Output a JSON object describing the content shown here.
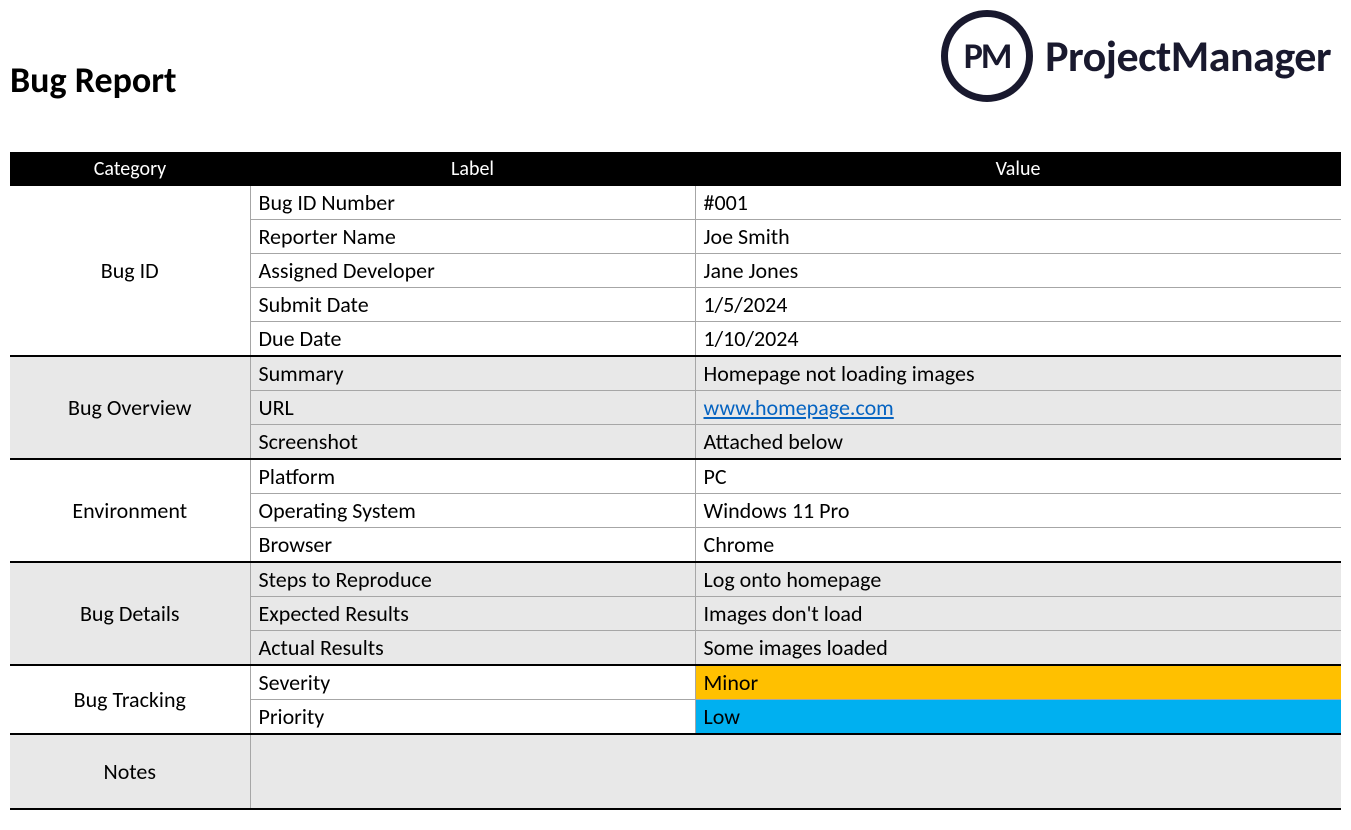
{
  "title": "Bug Report",
  "logo": {
    "initials": "PM",
    "brand": "ProjectManager"
  },
  "headers": {
    "category": "Category",
    "label": "Label",
    "value": "Value"
  },
  "sections": [
    {
      "category": "Bug ID",
      "shade": "odd",
      "rows": [
        {
          "label": "Bug ID Number",
          "value": "#001"
        },
        {
          "label": "Reporter Name",
          "value": "Joe Smith"
        },
        {
          "label": "Assigned Developer",
          "value": "Jane Jones"
        },
        {
          "label": "Submit Date",
          "value": "1/5/2024"
        },
        {
          "label": "Due Date",
          "value": "1/10/2024"
        }
      ]
    },
    {
      "category": "Bug Overview",
      "shade": "even",
      "rows": [
        {
          "label": "Summary",
          "value": "Homepage not loading images"
        },
        {
          "label": "URL",
          "value": "www.homepage.com",
          "link": true
        },
        {
          "label": "Screenshot",
          "value": "Attached below"
        }
      ]
    },
    {
      "category": "Environment",
      "shade": "odd",
      "rows": [
        {
          "label": "Platform",
          "value": "PC"
        },
        {
          "label": "Operating System",
          "value": "Windows 11 Pro"
        },
        {
          "label": "Browser",
          "value": "Chrome"
        }
      ]
    },
    {
      "category": "Bug Details",
      "shade": "even",
      "rows": [
        {
          "label": "Steps to Reproduce",
          "value": "Log onto homepage"
        },
        {
          "label": "Expected Results",
          "value": "Images don't load"
        },
        {
          "label": "Actual Results",
          "value": "Some images loaded"
        }
      ]
    },
    {
      "category": "Bug Tracking",
      "shade": "odd",
      "rows": [
        {
          "label": "Severity",
          "value": "Minor",
          "highlight": "severity"
        },
        {
          "label": "Priority",
          "value": "Low",
          "highlight": "priority"
        }
      ]
    }
  ],
  "notes": {
    "category": "Notes",
    "value": ""
  }
}
